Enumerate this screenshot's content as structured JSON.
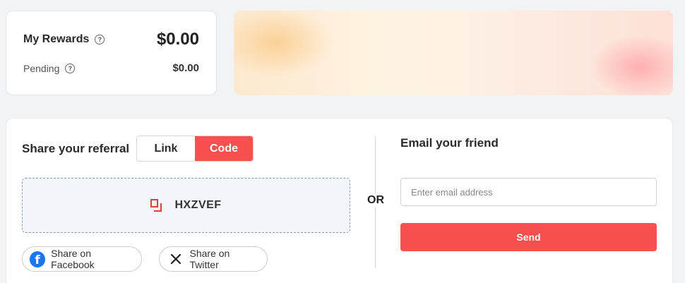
{
  "rewards": {
    "title": "My Rewards",
    "amount": "$0.00",
    "pending_label": "Pending",
    "pending_amount": "$0.00",
    "help_icon_glyph": "?"
  },
  "banner": {
    "colors": [
      "#fde9cf",
      "#fef3e2",
      "#fdeee4",
      "#fde0d8"
    ]
  },
  "share": {
    "title": "Share your referral",
    "toggle": {
      "options": [
        "Link",
        "Code"
      ],
      "selected": "Code"
    },
    "code": "HXZVEF",
    "facebook_label": "Share on Facebook",
    "facebook_glyph": "f",
    "twitter_label": "Share on Twitter",
    "or_label": "OR"
  },
  "email": {
    "title": "Email your friend",
    "placeholder": "Enter email address",
    "value": "",
    "send_label": "Send"
  },
  "colors": {
    "accent": "#f84f4f",
    "facebook": "#1877f2"
  },
  "icons": [
    "help-icon",
    "copy-icon",
    "facebook-icon",
    "x-twitter-icon"
  ]
}
